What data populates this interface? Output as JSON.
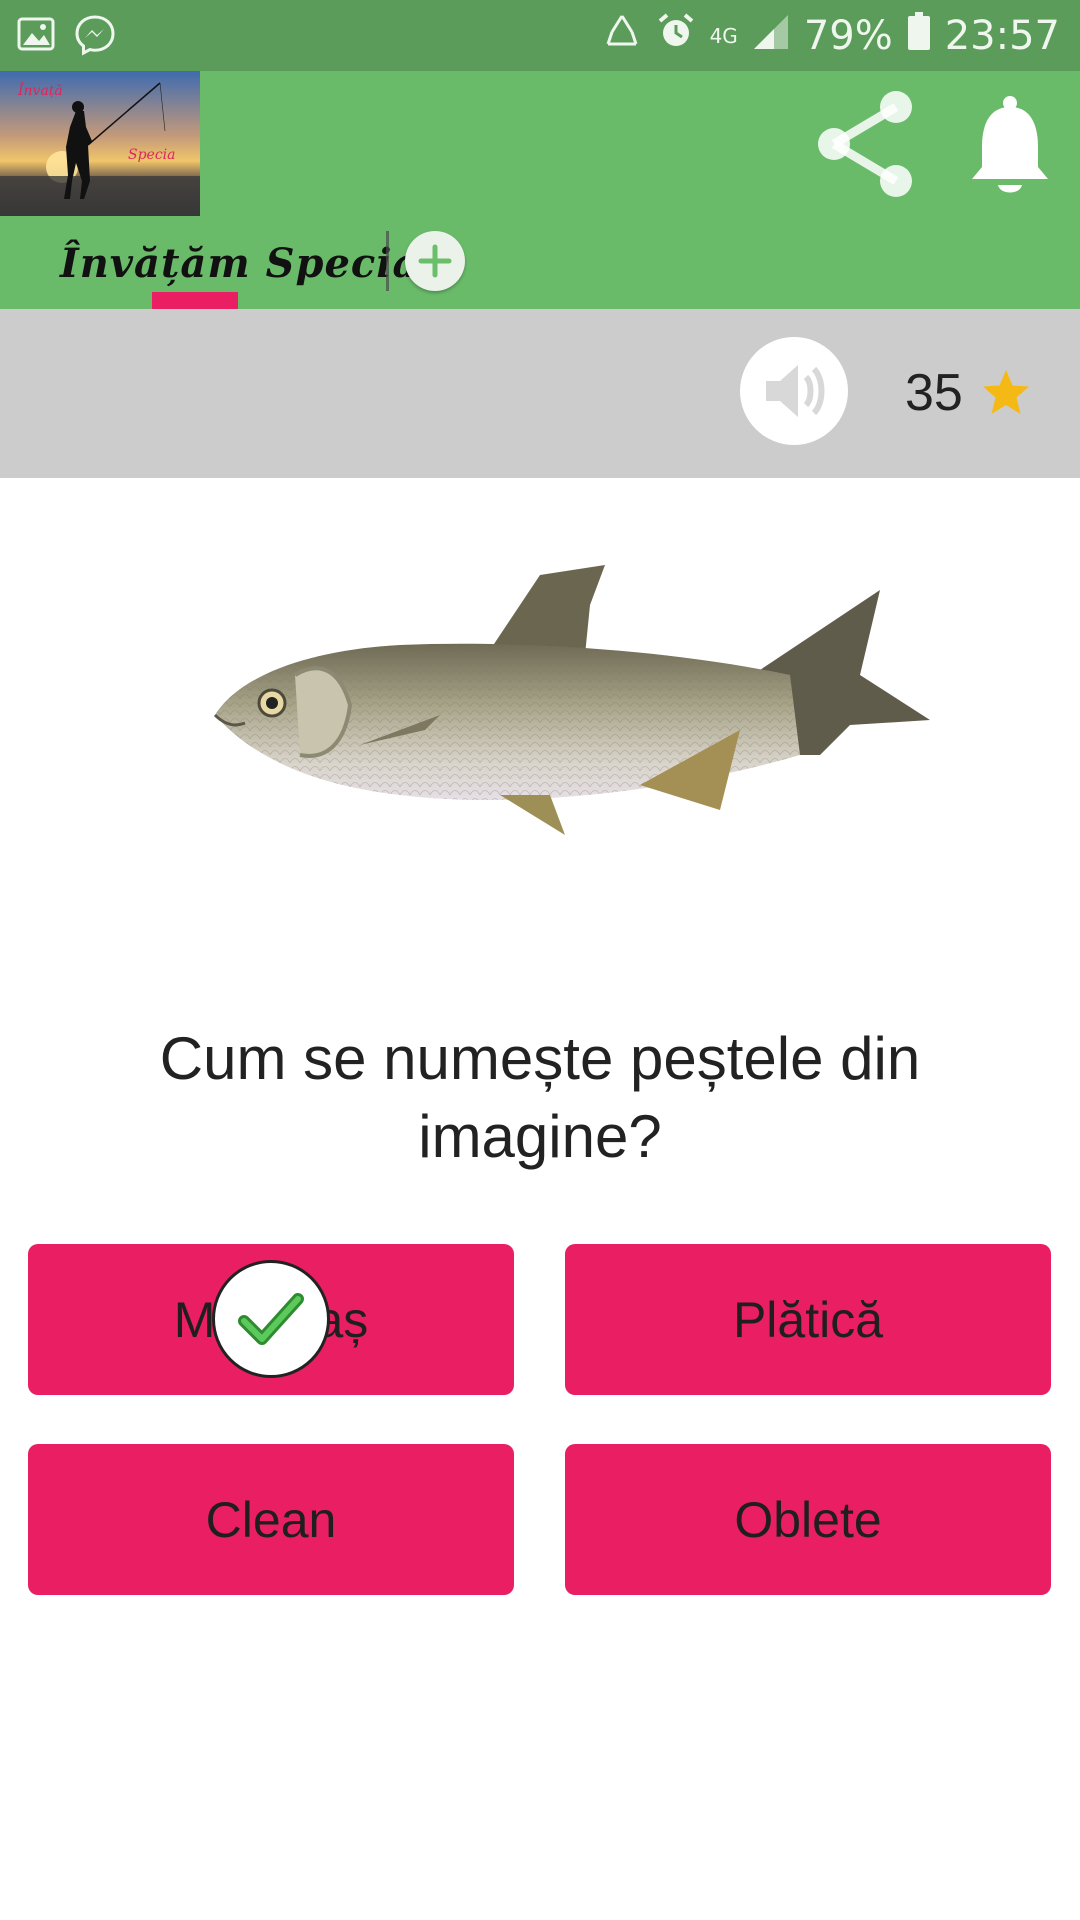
{
  "status_bar": {
    "icons": [
      "image-icon",
      "messenger-icon",
      "recycle-icon",
      "alarm-icon",
      "network-4g-icon",
      "signal-icon",
      "battery-icon"
    ],
    "network": "4G",
    "battery": "79%",
    "time": "23:57"
  },
  "app_bar": {
    "logo_text_top": "Învață",
    "logo_text_bottom": "Specia",
    "tab_label": "Învățăm Specia",
    "icons": [
      "share-icon",
      "bell-icon",
      "add-icon"
    ]
  },
  "score": {
    "value": "35",
    "icons": [
      "speaker-icon",
      "star-icon"
    ]
  },
  "quiz": {
    "question": "Cum se numește peștele din imagine?",
    "answers": [
      "Morunaș",
      "Plătică",
      "Clean",
      "Oblete"
    ],
    "selected_answer_icon": "checkmark-icon"
  },
  "colors": {
    "status_bar": "#5b9c5a",
    "app_bar": "#69bb6a",
    "accent": "#e91e63",
    "score_strip": "#cccccc",
    "star": "#f5b915"
  }
}
